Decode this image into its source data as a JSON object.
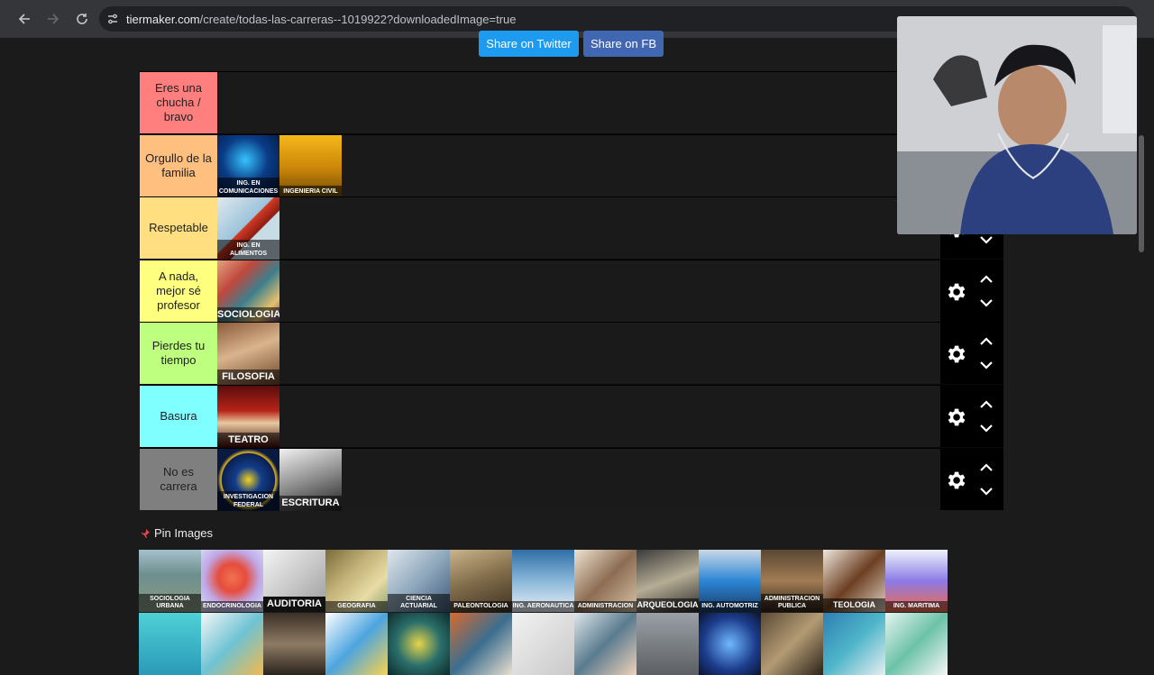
{
  "browser": {
    "url_host": "tiermaker.com",
    "url_path": "/create/todas-las-carreras--1019922?downloadedImage=true"
  },
  "share": {
    "twitter": "Share on Twitter",
    "facebook": "Share on FB"
  },
  "tiers": [
    {
      "label": "Eres una chucha / bravo",
      "color": "#ff7f7f",
      "items": []
    },
    {
      "label": "Orgullo de la familia",
      "color": "#ffbf7f",
      "items": [
        {
          "caption": "ING. EN COMUNICACIONES",
          "theme": "network"
        },
        {
          "caption": "INGENIERIA CIVIL",
          "theme": "helmet"
        }
      ]
    },
    {
      "label": "Respetable",
      "color": "#ffdf7f",
      "items": [
        {
          "caption": "ING. EN ALIMENTOS",
          "theme": "food"
        }
      ]
    },
    {
      "label": "A nada, mejor sé profesor",
      "color": "#ffff7f",
      "items": [
        {
          "caption": "SOCIOLOGIA",
          "theme": "crowd"
        }
      ]
    },
    {
      "label": "Pierdes tu tiempo",
      "color": "#bfff7f",
      "items": [
        {
          "caption": "FILOSOFIA",
          "theme": "fresco"
        }
      ]
    },
    {
      "label": "Basura",
      "color": "#7fffff",
      "items": [
        {
          "caption": "TEATRO",
          "theme": "stage"
        }
      ]
    },
    {
      "label": "No es carrera",
      "color": "#7f7f7f",
      "items": [
        {
          "caption": "INVESTIGACION FEDERAL",
          "theme": "fbi"
        },
        {
          "caption": "ESCRITURA",
          "theme": "typewriter"
        }
      ]
    }
  ],
  "pin_images_label": "Pin Images",
  "pool_row1": [
    {
      "caption": "SOCIOLOGIA URBANA",
      "theme": "city"
    },
    {
      "caption": "ENDOCRINOLOGIA",
      "theme": "body"
    },
    {
      "caption": "AUDITORIA",
      "theme": "audit"
    },
    {
      "caption": "GEOGRAFIA",
      "theme": "map"
    },
    {
      "caption": "CIENCIA ACTUARIAL",
      "theme": "graph"
    },
    {
      "caption": "PALEONTOLOGIA",
      "theme": "fossil"
    },
    {
      "caption": "ING. AERONAUTICA",
      "theme": "aero"
    },
    {
      "caption": "ADMINISTRACION",
      "theme": "office"
    },
    {
      "caption": "ARQUEOLOGIA",
      "theme": "skull"
    },
    {
      "caption": "ING. AUTOMOTRIZ",
      "theme": "car"
    },
    {
      "caption": "ADMINISTRACION PUBLICA",
      "theme": "hall"
    },
    {
      "caption": "TEOLOGIA",
      "theme": "chess"
    },
    {
      "caption": "ING. MARITIMA",
      "theme": "ship"
    }
  ],
  "pool_row2": [
    {
      "theme": "bulb"
    },
    {
      "theme": "puzzle"
    },
    {
      "theme": "rail"
    },
    {
      "theme": "chat"
    },
    {
      "theme": "circuit"
    },
    {
      "theme": "workers"
    },
    {
      "theme": "sketch"
    },
    {
      "theme": "teacher"
    },
    {
      "theme": "tower"
    },
    {
      "theme": "robot"
    },
    {
      "theme": "statue"
    },
    {
      "theme": "board"
    },
    {
      "theme": "doctor"
    }
  ],
  "icons": {
    "back": "arrow-left-icon",
    "forward": "arrow-right-icon",
    "reload": "reload-icon",
    "site_info": "tune-icon",
    "pin": "pushpin-icon",
    "gear": "gear-icon",
    "up": "chevron-up-icon",
    "down": "chevron-down-icon"
  }
}
